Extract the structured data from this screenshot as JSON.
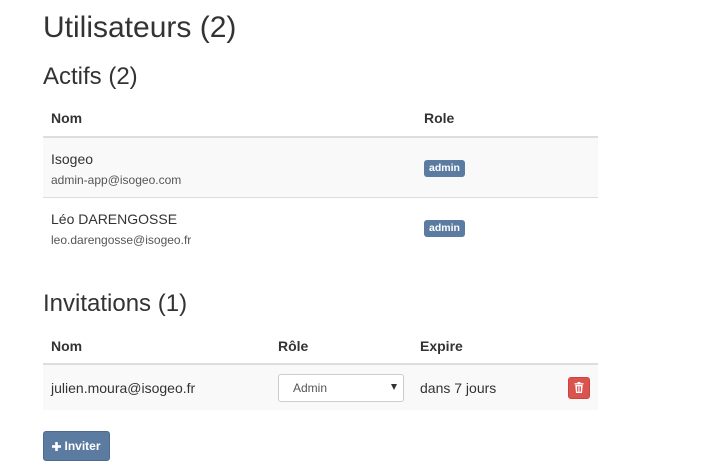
{
  "page": {
    "title": "Utilisateurs (2)"
  },
  "actifs": {
    "title": "Actifs (2)",
    "columns": {
      "name": "Nom",
      "role": "Role"
    },
    "users": [
      {
        "name": "Isogeo",
        "email": "admin-app@isogeo.com",
        "role": "admin"
      },
      {
        "name": "Léo DARENGOSSE",
        "email": "leo.darengosse@isogeo.fr",
        "role": "admin"
      }
    ]
  },
  "invitations": {
    "title": "Invitations (1)",
    "columns": {
      "name": "Nom",
      "role": "Rôle",
      "expires": "Expire"
    },
    "rows": [
      {
        "email": "julien.moura@isogeo.fr",
        "role_selected": "Admin",
        "expires": "dans 7 jours"
      }
    ]
  },
  "actions": {
    "invite_label": "Inviter",
    "invite_icon": "plus-icon",
    "delete_icon": "trash-icon"
  },
  "colors": {
    "label_primary": "#5b7ba1",
    "danger": "#d9534f"
  }
}
